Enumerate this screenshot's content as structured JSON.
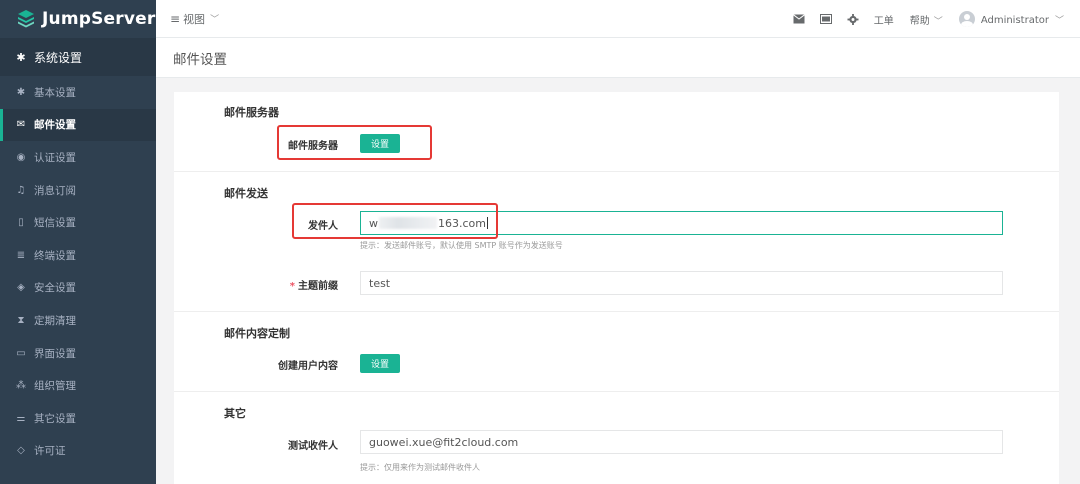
{
  "brand": {
    "name": "JumpServer"
  },
  "sidebar": {
    "header": {
      "label": "系统设置",
      "icon": "gear-icon"
    },
    "items": [
      {
        "label": "基本设置",
        "icon": "gear-icon"
      },
      {
        "label": "邮件设置",
        "icon": "envelope-icon",
        "active": true
      },
      {
        "label": "认证设置",
        "icon": "user-circle-icon"
      },
      {
        "label": "消息订阅",
        "icon": "bell-icon"
      },
      {
        "label": "短信设置",
        "icon": "mobile-icon"
      },
      {
        "label": "终端设置",
        "icon": "terminal-icon"
      },
      {
        "label": "安全设置",
        "icon": "shield-icon"
      },
      {
        "label": "定期清理",
        "icon": "hourglass-icon"
      },
      {
        "label": "界面设置",
        "icon": "laptop-icon"
      },
      {
        "label": "组织管理",
        "icon": "sitemap-icon"
      },
      {
        "label": "其它设置",
        "icon": "sliders-icon"
      },
      {
        "label": "许可证",
        "icon": "diamond-icon"
      }
    ]
  },
  "topbar": {
    "view_menu": "视图",
    "tickets": "工单",
    "help": "帮助",
    "user": "Administrator"
  },
  "page": {
    "title": "邮件设置"
  },
  "sections": {
    "server": {
      "title": "邮件服务器",
      "row_label": "邮件服务器",
      "button": "设置"
    },
    "sending": {
      "title": "邮件发送",
      "sender": {
        "label": "发件人",
        "value_prefix": "w",
        "value_suffix": "163.com",
        "help": "提示：发送邮件账号，默认使用 SMTP 账号作为发送账号"
      },
      "subject_prefix": {
        "required_mark": "*",
        "label": "主题前缀",
        "value": "test"
      }
    },
    "custom": {
      "title": "邮件内容定制",
      "row_label": "创建用户内容",
      "button": "设置"
    },
    "other": {
      "title": "其它",
      "test_recipient": {
        "label": "测试收件人",
        "value": "guowei.xue@fit2cloud.com",
        "help": "提示：仅用来作为测试邮件收件人"
      }
    }
  },
  "colors": {
    "sidebar_bg": "#2f4050",
    "accent": "#1ab394",
    "annotation": "#e53935"
  }
}
